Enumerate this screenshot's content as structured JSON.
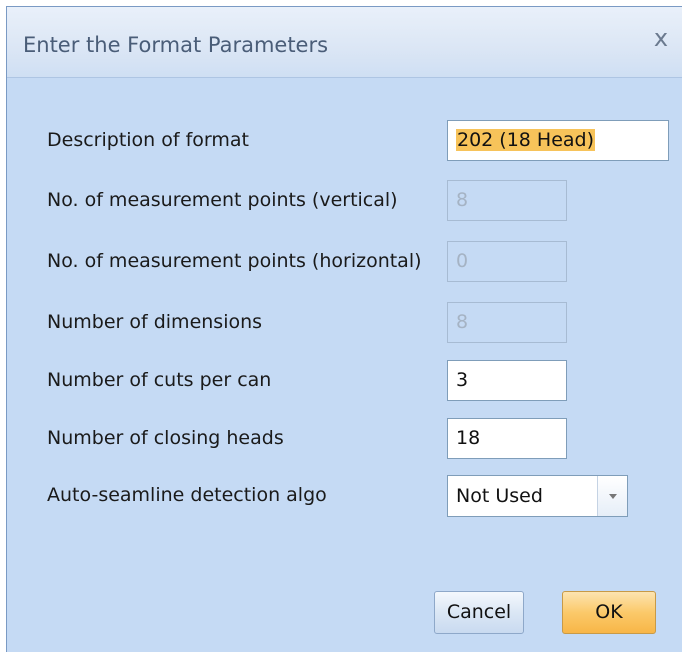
{
  "dialog": {
    "title": "Enter the Format Parameters",
    "close_glyph": "x"
  },
  "fields": [
    {
      "label": "Description of format",
      "value": "202 (18 Head)",
      "enabled": true,
      "selected": true
    },
    {
      "label": "No. of measurement points (vertical)",
      "value": "8",
      "enabled": false
    },
    {
      "label": "No. of measurement points (horizontal)",
      "value": "0",
      "enabled": false
    },
    {
      "label": "Number of dimensions",
      "value": "8",
      "enabled": false
    },
    {
      "label": "Number of cuts per can",
      "value": "3",
      "enabled": true
    },
    {
      "label": "Number of closing heads",
      "value": "18",
      "enabled": true
    }
  ],
  "algo": {
    "label": "Auto-seamline detection algo",
    "value": "Not Used"
  },
  "buttons": {
    "cancel": "Cancel",
    "ok": "OK"
  },
  "icons": {
    "close": "close-icon",
    "dropdown": "chevron-down-icon"
  },
  "colors": {
    "dialog_bg": "#c5daf4",
    "selection_highlight": "#f7c35a",
    "ok_button": "#fbc96a"
  }
}
